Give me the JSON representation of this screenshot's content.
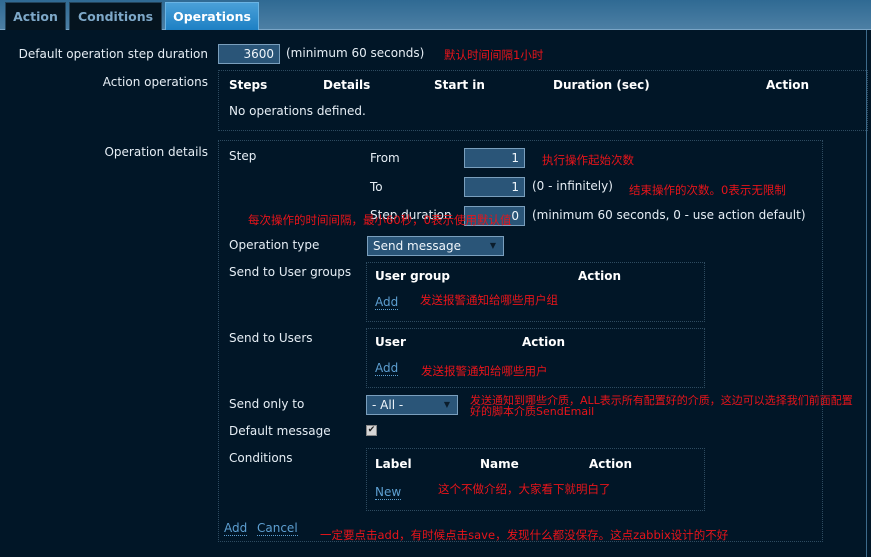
{
  "tabs": [
    {
      "label": "Action",
      "active": false
    },
    {
      "label": "Conditions",
      "active": false
    },
    {
      "label": "Operations",
      "active": true
    }
  ],
  "default_step": {
    "label": "Default operation step duration",
    "value": "3600",
    "hint": "(minimum 60 seconds)",
    "note": "默认时间间隔1小时"
  },
  "action_operations": {
    "label": "Action operations",
    "columns": [
      "Steps",
      "Details",
      "Start in",
      "Duration (sec)",
      "Action"
    ],
    "empty_text": "No operations defined."
  },
  "operation_details": {
    "label": "Operation details",
    "step": {
      "label": "Step",
      "from_label": "From",
      "from_value": "1",
      "from_note": "执行操作起始次数",
      "to_label": "To",
      "to_value": "1",
      "to_hint": "(0 - infinitely)",
      "to_note": "结束操作的次数。0表示无限制",
      "duration_label": "Step duration",
      "duration_value": "0",
      "duration_hint": "(minimum 60 seconds, 0 - use action default)",
      "duration_note": "每次操作的时间间隔，最小60秒，0表示使用默认值"
    },
    "operation_type": {
      "label": "Operation type",
      "selected": "Send message"
    },
    "user_groups": {
      "label": "Send to User groups",
      "columns": [
        "User group",
        "Action"
      ],
      "add_label": "Add",
      "note": "发送报警通知给哪些用户组"
    },
    "users": {
      "label": "Send to Users",
      "columns": [
        "User",
        "Action"
      ],
      "add_label": "Add",
      "note": "发送报警通知给哪些用户"
    },
    "send_only_to": {
      "label": "Send only to",
      "selected": "- All -",
      "note_line1": "发送通知到哪些介质，ALL表示所有配置好的介质，这边可以选择我们前面配置",
      "note_line2": "好的脚本介质SendEmail"
    },
    "default_message": {
      "label": "Default message",
      "checked": true,
      "check_glyph": "✔"
    },
    "conditions": {
      "label": "Conditions",
      "columns": [
        "Label",
        "Name",
        "Action"
      ],
      "new_label": "New",
      "note": "这个不做介绍，大家看下就明白了"
    },
    "footer": {
      "add_label": "Add",
      "cancel_label": "Cancel",
      "note": "一定要点击add，有时候点击save，发现什么都没保存。这点zabbix设计的不好"
    }
  },
  "icons": {
    "caret": "▼"
  }
}
